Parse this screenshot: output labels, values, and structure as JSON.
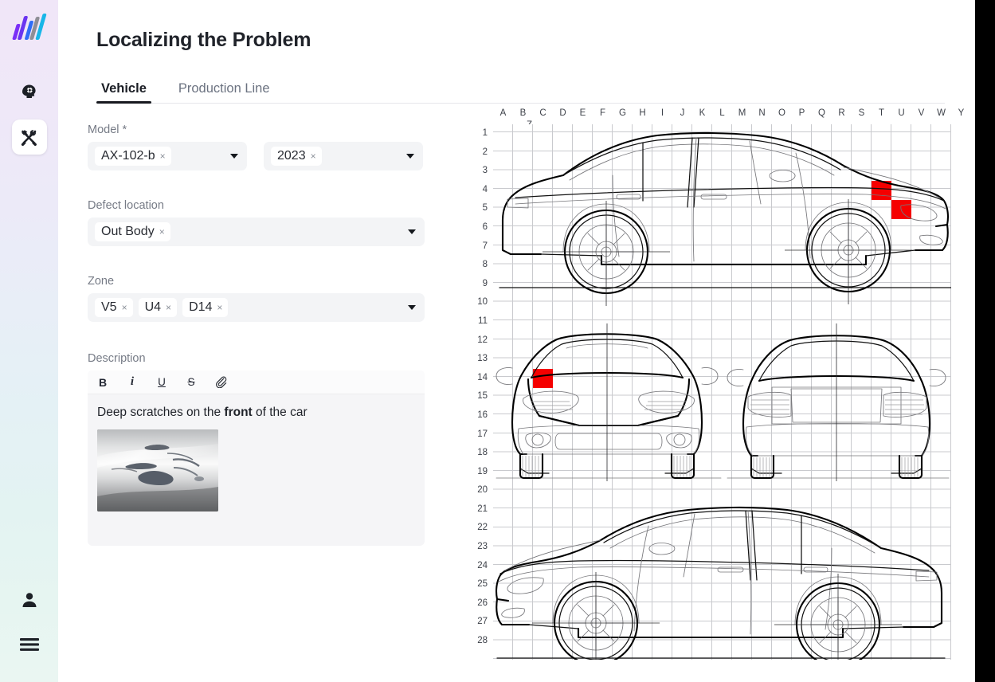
{
  "app": {
    "logo_name": "analytics-logo",
    "logo_colors": [
      "#7b2ff7",
      "#2f6df7",
      "#8e8e96",
      "#18b6e8",
      "#7b2ff7"
    ]
  },
  "sidebar": {
    "nav_items": [
      {
        "name": "ai-head-icon",
        "label": "AI Assistant",
        "active": false
      },
      {
        "name": "tools-icon",
        "label": "Maintenance Tools",
        "active": true
      }
    ],
    "bottom_items": [
      {
        "name": "user-icon",
        "label": "Account"
      },
      {
        "name": "menu-icon",
        "label": "Menu"
      }
    ]
  },
  "header": {
    "title": "Localizing the Problem"
  },
  "tabs": [
    {
      "label": "Vehicle",
      "active": true
    },
    {
      "label": "Production Line",
      "active": false
    }
  ],
  "form": {
    "model": {
      "label": "Model *",
      "model_chip": "AX-102-b",
      "year_chip": "2023",
      "chip_remove": "×"
    },
    "defect_location": {
      "label": "Defect location",
      "chip": "Out Body"
    },
    "zone": {
      "label": "Zone",
      "chips": [
        "V5",
        "U4",
        "D14"
      ]
    },
    "description": {
      "label": "Description",
      "toolbar": [
        {
          "name": "bold-button",
          "glyph": "B"
        },
        {
          "name": "italic-button",
          "glyph": "i"
        },
        {
          "name": "underline-button",
          "glyph": "U"
        },
        {
          "name": "strikethrough-button",
          "glyph": "S"
        },
        {
          "name": "attachment-button",
          "glyph": "📎"
        }
      ],
      "text_before": "Deep scratches on the ",
      "text_bold": "front",
      "text_after": " of the car",
      "attachment_alt": "Photo of deep scratches on silver car body panel"
    }
  },
  "blueprint": {
    "columns": [
      "A",
      "B",
      "C",
      "D",
      "E",
      "F",
      "G",
      "H",
      "I",
      "J",
      "K",
      "L",
      "M",
      "N",
      "O",
      "P",
      "Q",
      "R",
      "S",
      "T",
      "U",
      "V",
      "W",
      "Y"
    ],
    "z_label": "Z",
    "rows": [
      1,
      2,
      3,
      4,
      5,
      6,
      7,
      8,
      9,
      10,
      11,
      12,
      13,
      14,
      15,
      16,
      17,
      18,
      19,
      20,
      21,
      22,
      23,
      24,
      25,
      26,
      27,
      28
    ],
    "marker_color": "#f50000",
    "markers": [
      {
        "view": "side-top",
        "column": "T",
        "row": 4
      },
      {
        "view": "side-top",
        "column": "U",
        "row": 5
      },
      {
        "view": "front",
        "column": "C",
        "row": 14
      }
    ],
    "views": [
      {
        "name": "side-view-right",
        "rows": "1-9"
      },
      {
        "name": "front-view",
        "rows": "11-18"
      },
      {
        "name": "rear-view",
        "rows": "11-18"
      },
      {
        "name": "side-view-left",
        "rows": "20-28"
      }
    ]
  }
}
